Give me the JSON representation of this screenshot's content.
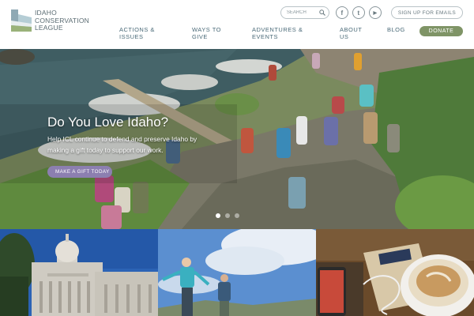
{
  "logo": {
    "line1": "IDAHO",
    "line2": "CONSERVATION",
    "line3": "LEAGUE"
  },
  "search": {
    "placeholder": "SEARCH"
  },
  "social": [
    {
      "name": "facebook",
      "glyph": "f"
    },
    {
      "name": "twitter",
      "glyph": "t"
    },
    {
      "name": "youtube",
      "glyph": "▶"
    }
  ],
  "signup_label": "SIGN UP FOR EMAILS",
  "nav": {
    "items": [
      {
        "line1": "ACTIONS &",
        "line2": "ISSUES"
      },
      {
        "line1": "WAYS TO",
        "line2": "GIVE"
      },
      {
        "line1": "ADVENTURES &",
        "line2": "EVENTS"
      },
      {
        "line1": "ABOUT",
        "line2": "US"
      },
      {
        "line1": "BLOG",
        "line2": ""
      }
    ],
    "donate_label": "DONATE"
  },
  "hero": {
    "title": "Do You Love Idaho?",
    "subtitle": "Help ICL continue to defend and preserve Idaho by making a gift today to support our work.",
    "cta_label": "MAKE A GIFT TODAY",
    "slide_count": 3,
    "active_slide": 1
  },
  "colors": {
    "accent_green": "#7f9466",
    "cta_purple": "#8c7fb0",
    "nav_text": "#4a6a78"
  }
}
